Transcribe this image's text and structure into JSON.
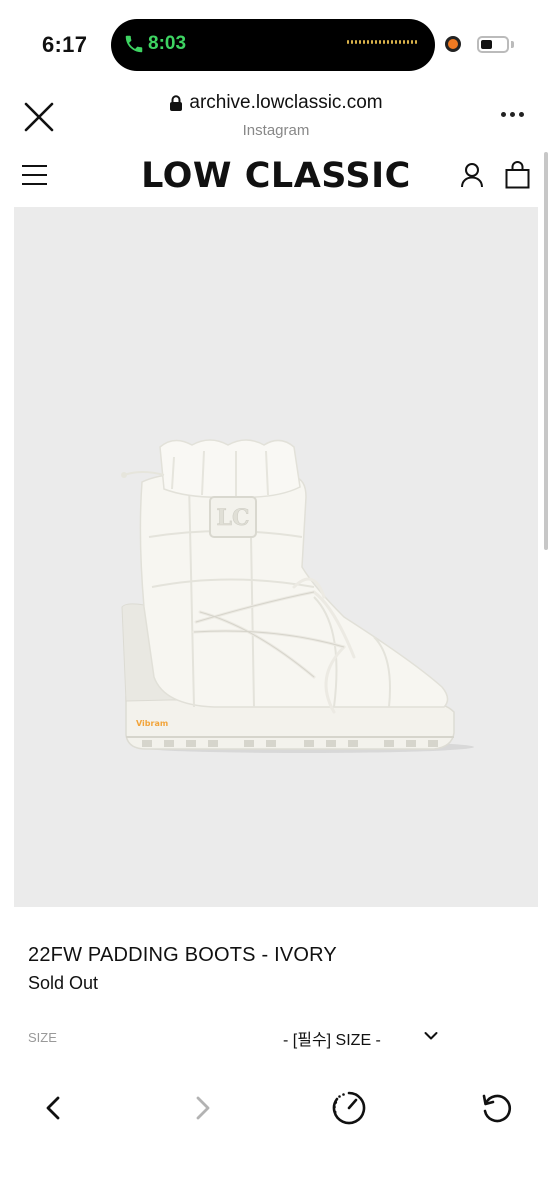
{
  "status_bar": {
    "time": "6:17",
    "call_time": "8:03",
    "call_color": "#3ed462",
    "battery_level": 0.45
  },
  "browser": {
    "url": "archive.lowclassic.com",
    "source": "Instagram",
    "close_icon": "close-icon",
    "more_icon": "more-icon"
  },
  "site": {
    "logo": "LOW CLASSIC",
    "menu_icon": "hamburger-icon",
    "account_icon": "user-icon",
    "cart_icon": "shopping-bag-icon"
  },
  "product": {
    "image_description_icon": "boot-image",
    "title": "22FW PADDING BOOTS - IVORY",
    "status": "Sold Out",
    "size_label": "SIZE",
    "size_value": "- [필수] SIZE -"
  },
  "toolbar": {
    "back_icon": "chevron-left-icon",
    "forward_icon": "chevron-right-icon",
    "speed_icon": "speedometer-icon",
    "reload_icon": "reload-icon"
  }
}
